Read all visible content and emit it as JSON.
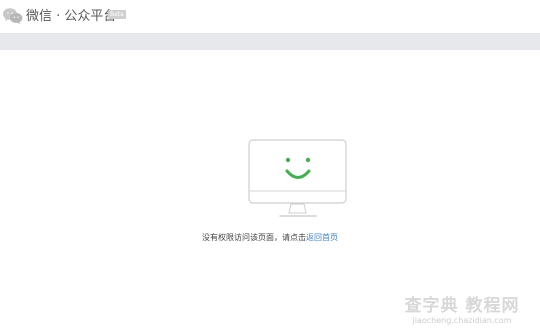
{
  "header": {
    "brand": "微信 · 公众平台",
    "badge": "Beta",
    "logo_icon": "wechat-logo-icon"
  },
  "main": {
    "illustration_icon": "smiling-monitor-icon",
    "message_prefix": "没有权限访问该页面，请点击",
    "return_home_link": "返回首页",
    "accent_color": "#3fb24e",
    "link_color": "#3c83d3"
  },
  "watermark": {
    "title": "查字典 教程网",
    "url": "jiaocheng.chazidian.com"
  }
}
